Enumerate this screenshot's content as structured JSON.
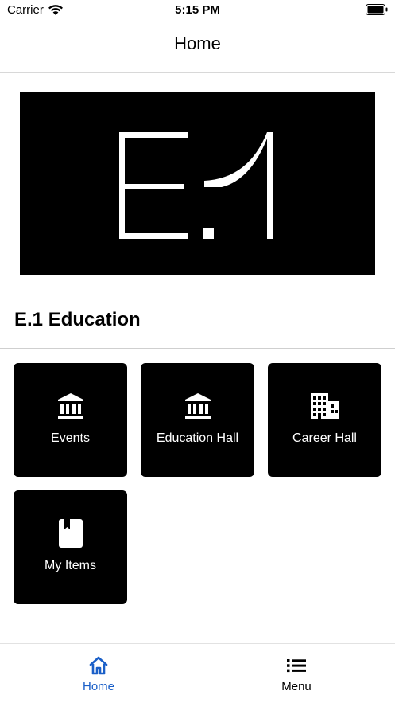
{
  "status_bar": {
    "carrier": "Carrier",
    "time": "5:15 PM",
    "wifi_icon": "wifi-icon",
    "battery_icon": "battery-icon"
  },
  "header": {
    "title": "Home"
  },
  "banner": {
    "logo_text": "E.1"
  },
  "section": {
    "title": "E.1 Education"
  },
  "tiles": [
    {
      "label": "Events",
      "icon": "bank-icon"
    },
    {
      "label": "Education Hall",
      "icon": "bank-icon"
    },
    {
      "label": "Career Hall",
      "icon": "building-icon"
    },
    {
      "label": "My Items",
      "icon": "bookmark-book-icon"
    }
  ],
  "tab_bar": {
    "items": [
      {
        "label": "Home",
        "icon": "home-icon",
        "active": true
      },
      {
        "label": "Menu",
        "icon": "list-icon",
        "active": false
      }
    ]
  },
  "colors": {
    "accent": "#1a5fc8",
    "tile_background": "#000000",
    "banner_background": "#000000"
  }
}
